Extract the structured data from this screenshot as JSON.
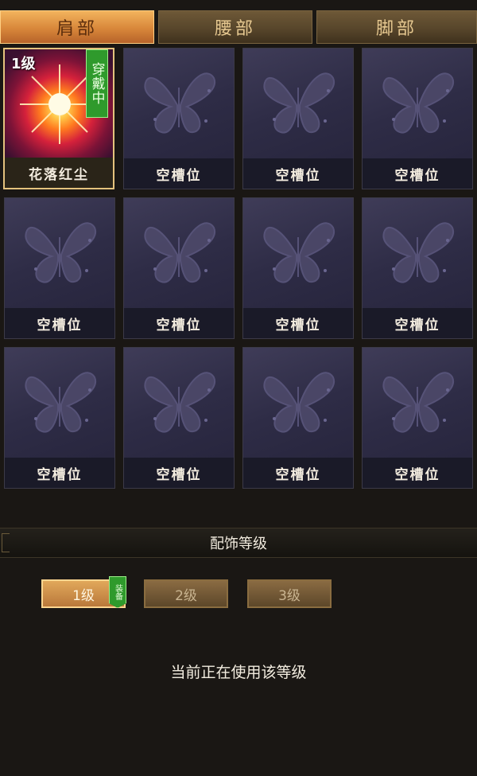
{
  "tabs": [
    {
      "label": "肩部",
      "active": true
    },
    {
      "label": "腰部",
      "active": false
    },
    {
      "label": "脚部",
      "active": false
    }
  ],
  "slots": [
    {
      "label": "花落红尘",
      "level": "1级",
      "status": "穿戴中",
      "equipped": true
    },
    {
      "label": "空槽位"
    },
    {
      "label": "空槽位"
    },
    {
      "label": "空槽位"
    },
    {
      "label": "空槽位"
    },
    {
      "label": "空槽位"
    },
    {
      "label": "空槽位"
    },
    {
      "label": "空槽位"
    },
    {
      "label": "空槽位"
    },
    {
      "label": "空槽位"
    },
    {
      "label": "空槽位"
    },
    {
      "label": "空槽位"
    }
  ],
  "section": {
    "title": "配饰等级"
  },
  "levels": [
    {
      "label": "1级",
      "active": true,
      "tag": "装备"
    },
    {
      "label": "2级",
      "active": false
    },
    {
      "label": "3级",
      "active": false
    }
  ],
  "status_text": "当前正在使用该等级",
  "colors": {
    "accent": "#e4c27d",
    "equipped_badge": "#2f9a2c",
    "slot_bg": "#2e2c46"
  }
}
